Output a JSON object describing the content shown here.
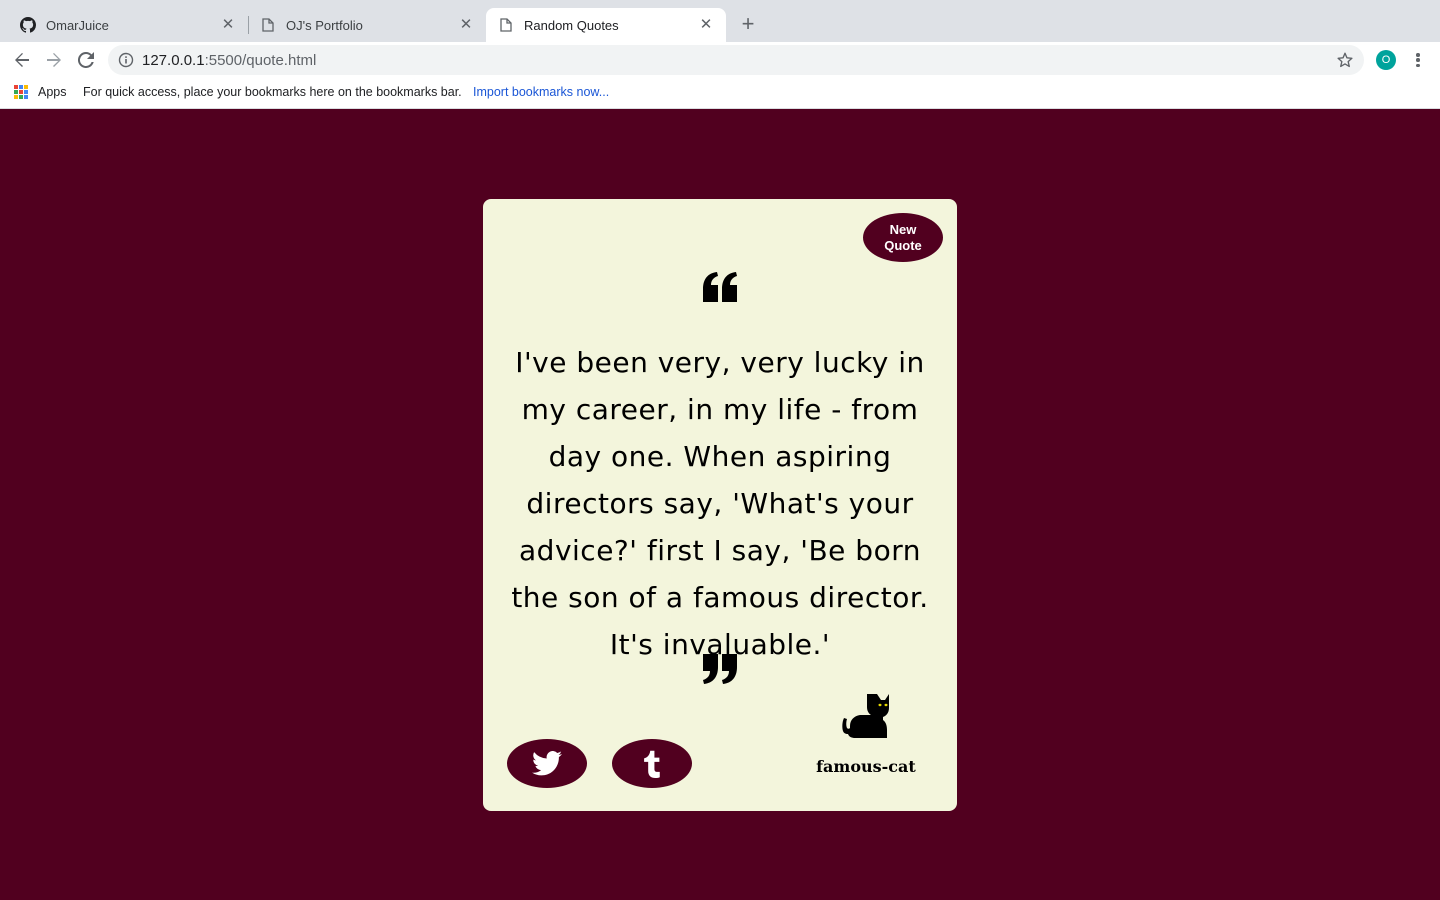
{
  "browser": {
    "tabs": [
      {
        "title": "OmarJuice",
        "icon": "github-icon"
      },
      {
        "title": "OJ's Portfolio",
        "icon": "page-icon"
      },
      {
        "title": "Random Quotes",
        "icon": "page-icon",
        "active": true
      }
    ],
    "url_host": "127.0.0.1",
    "url_path": ":5500/quote.html",
    "profile_initial": "O",
    "bookmarks_bar": {
      "apps_label": "Apps",
      "message": "For quick access, place your bookmarks here on the bookmarks bar.",
      "import_link": "Import bookmarks now..."
    }
  },
  "page": {
    "background_color": "#51001f",
    "card_color": "#f3f5dc",
    "new_quote_label": "New Quote",
    "quote_text": "I've been very, very lucky in my career, in my life - from day one. When aspiring directors say, 'What's your advice?' first I say, 'Be born the son of a famous director. It's invaluable.'",
    "author": "famous-cat",
    "share_buttons": [
      "twitter-icon",
      "tumblr-icon"
    ]
  }
}
